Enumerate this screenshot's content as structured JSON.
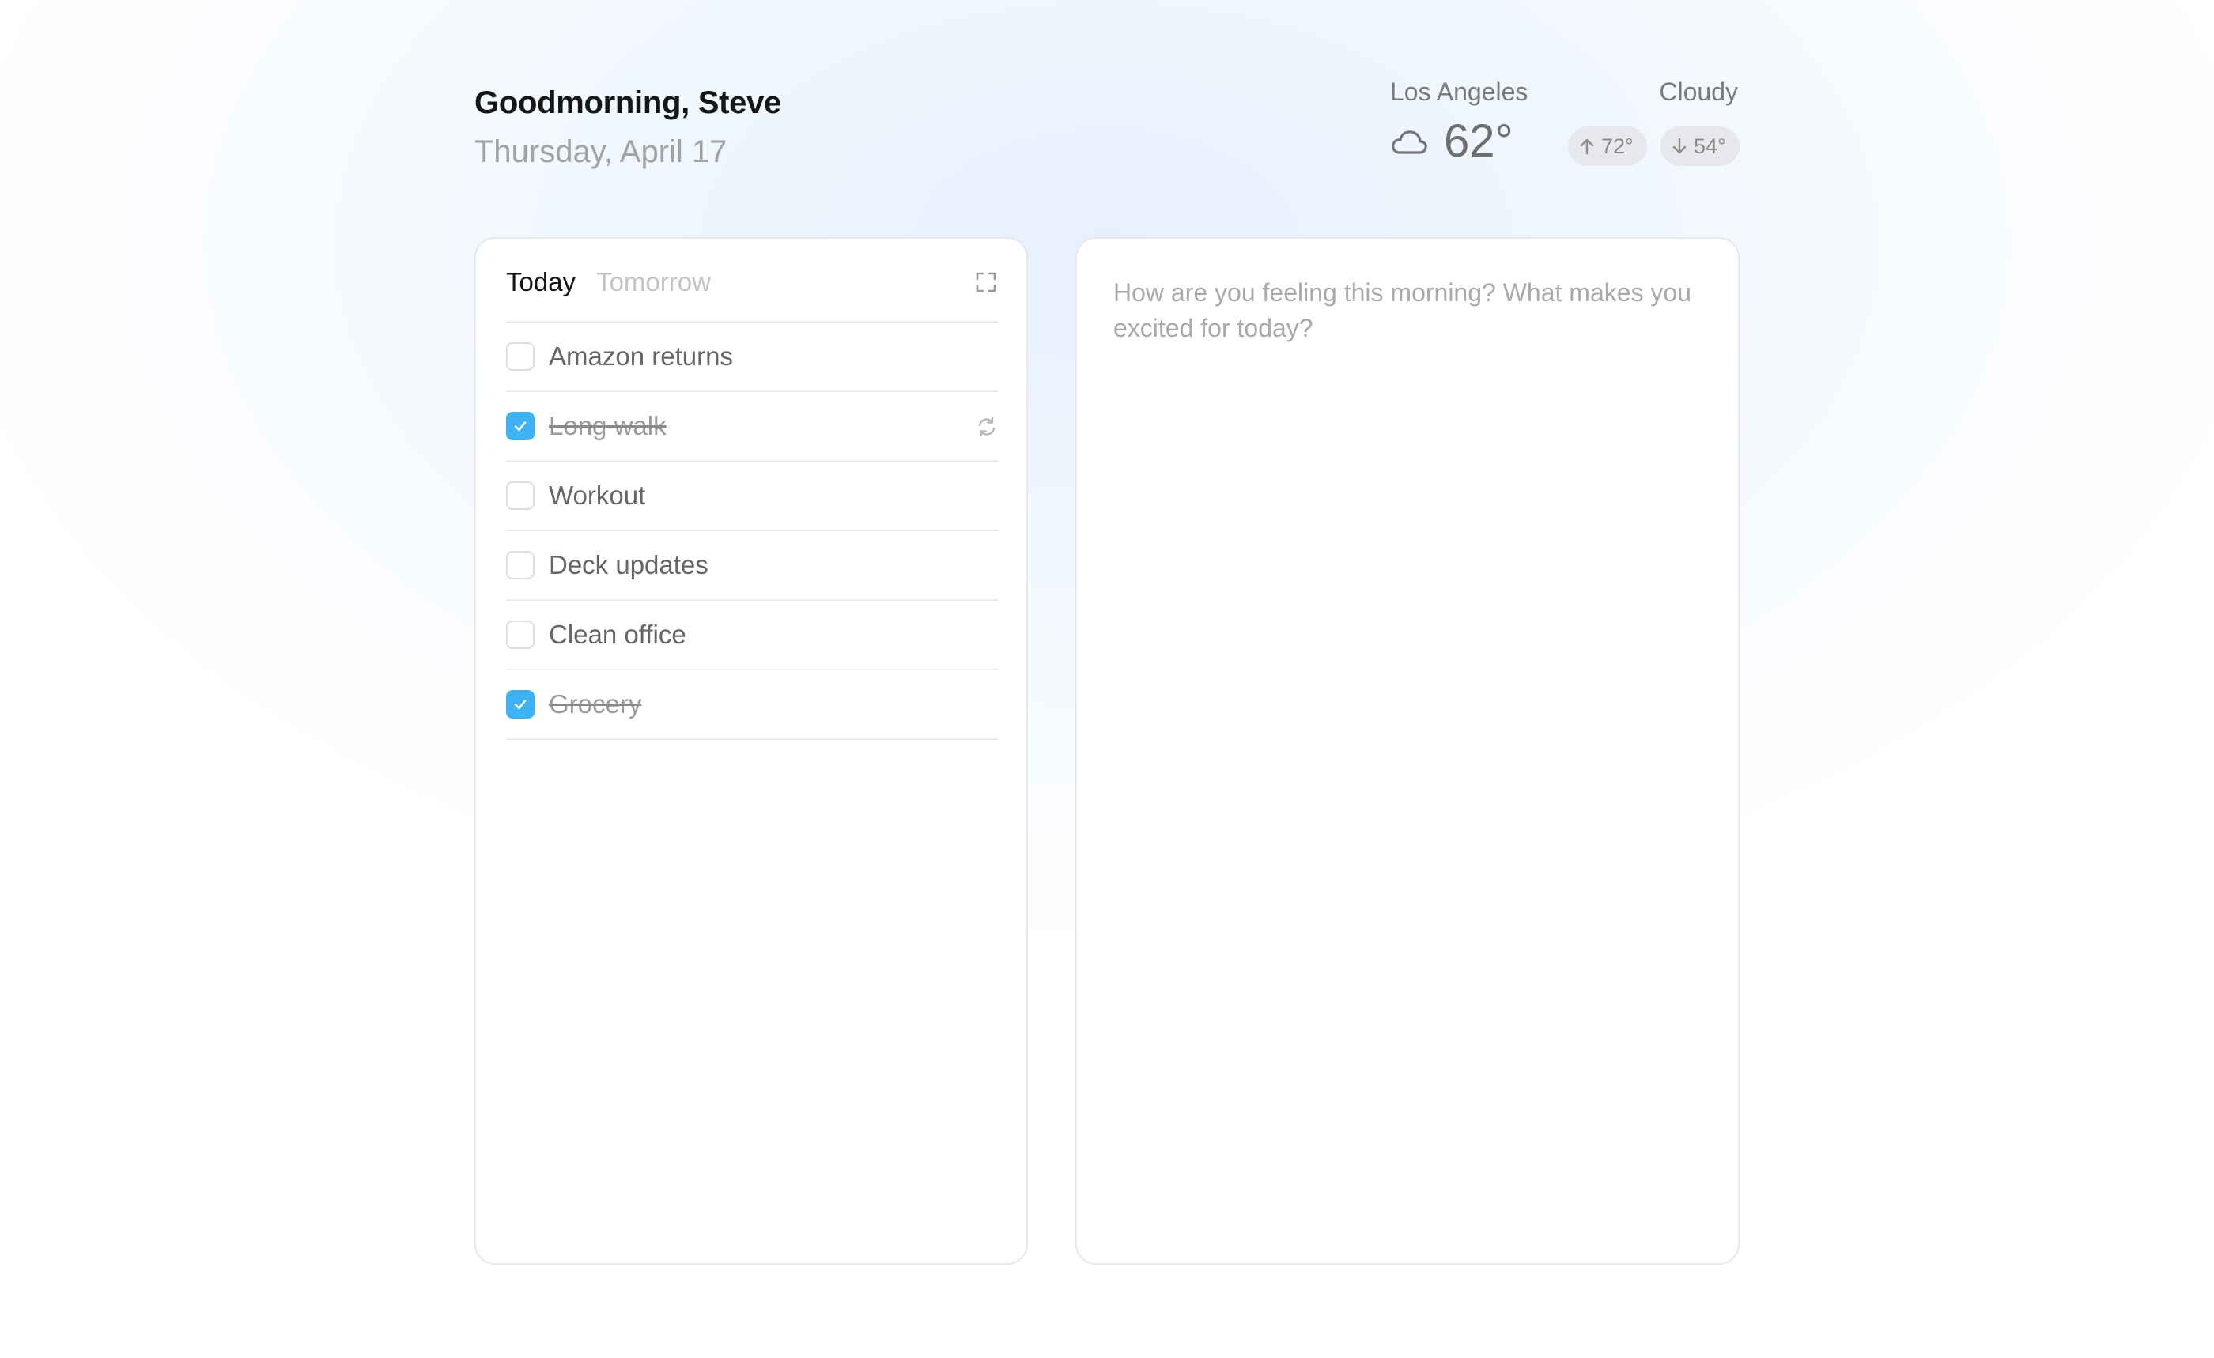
{
  "header": {
    "greeting": "Goodmorning, Steve",
    "date": "Thursday, April 17"
  },
  "weather": {
    "city": "Los Angeles",
    "condition": "Cloudy",
    "condition_icon": "cloud-icon",
    "temperature": "62°",
    "high": "72°",
    "low": "54°"
  },
  "tasks": {
    "tabs": [
      {
        "label": "Today",
        "active": true
      },
      {
        "label": "Tomorrow",
        "active": false
      }
    ],
    "items": [
      {
        "label": "Amazon returns",
        "done": false
      },
      {
        "label": "Long walk",
        "done": true,
        "repeat": true
      },
      {
        "label": "Workout",
        "done": false
      },
      {
        "label": "Deck updates",
        "done": false
      },
      {
        "label": "Clean office",
        "done": false
      },
      {
        "label": "Grocery",
        "done": true
      }
    ]
  },
  "journal": {
    "placeholder": "How are you feeling this morning? What makes you excited for today?"
  },
  "colors": {
    "accent": "#3db2f4",
    "muted_text": "#a3a3a3"
  }
}
